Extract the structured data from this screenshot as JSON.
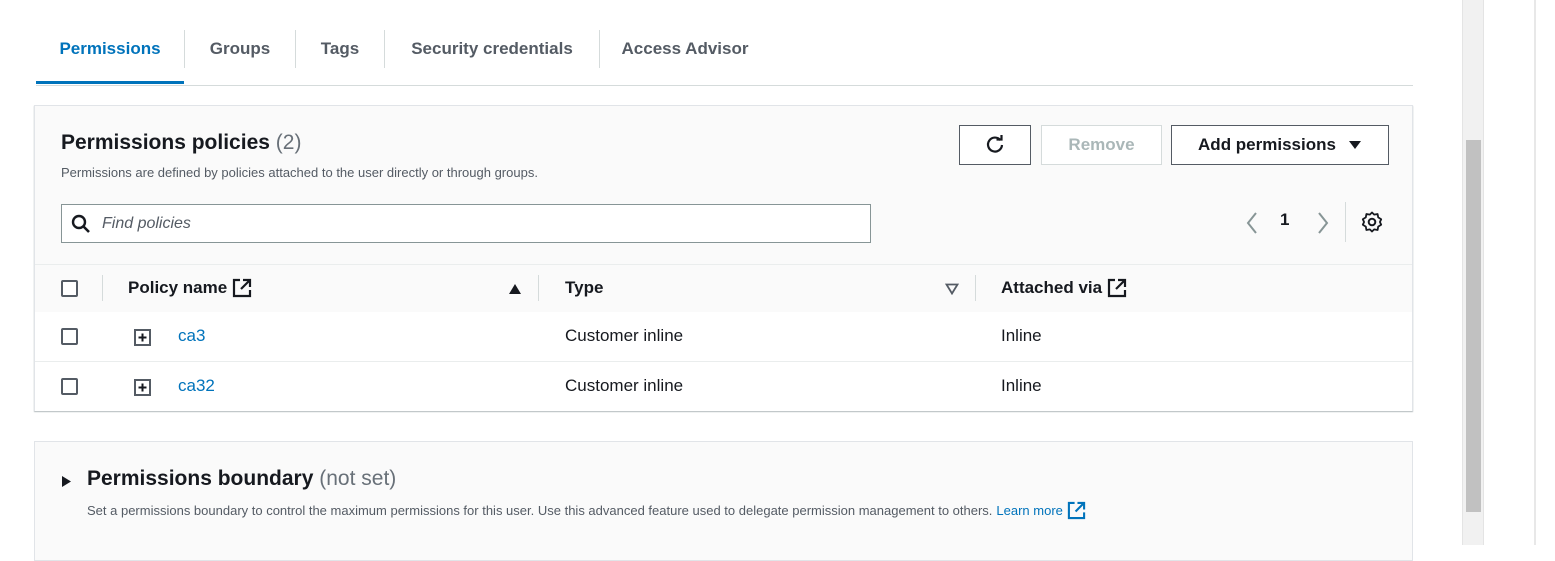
{
  "tabs": [
    {
      "label": "Permissions",
      "active": true
    },
    {
      "label": "Groups"
    },
    {
      "label": "Tags"
    },
    {
      "label": "Security credentials"
    },
    {
      "label": "Access Advisor"
    }
  ],
  "policies": {
    "title": "Permissions policies",
    "count": "(2)",
    "description": "Permissions are defined by policies attached to the user directly or through groups.",
    "remove_label": "Remove",
    "add_label": "Add permissions",
    "search_placeholder": "Find policies",
    "page": "1",
    "columns": {
      "policy_name": "Policy name",
      "type": "Type",
      "attached_via": "Attached via"
    },
    "rows": [
      {
        "name": "ca3",
        "type": "Customer inline",
        "attached_via": "Inline"
      },
      {
        "name": "ca32",
        "type": "Customer inline",
        "attached_via": "Inline"
      }
    ]
  },
  "boundary": {
    "title": "Permissions boundary",
    "status": "(not set)",
    "description": "Set a permissions boundary to control the maximum permissions for this user. Use this advanced feature used to delegate permission management to others.",
    "learn_more": "Learn more"
  },
  "colors": {
    "accent": "#0073bb",
    "text": "#16191f",
    "muted": "#545b64",
    "disabled": "#aab7b8"
  },
  "icons": [
    "refresh-icon",
    "caret-down-icon",
    "search-icon",
    "chevron-left-icon",
    "chevron-right-icon",
    "settings-icon",
    "external-link-icon",
    "sort-ascending-icon",
    "sort-descending-icon",
    "expand-icon",
    "caret-right-icon"
  ]
}
